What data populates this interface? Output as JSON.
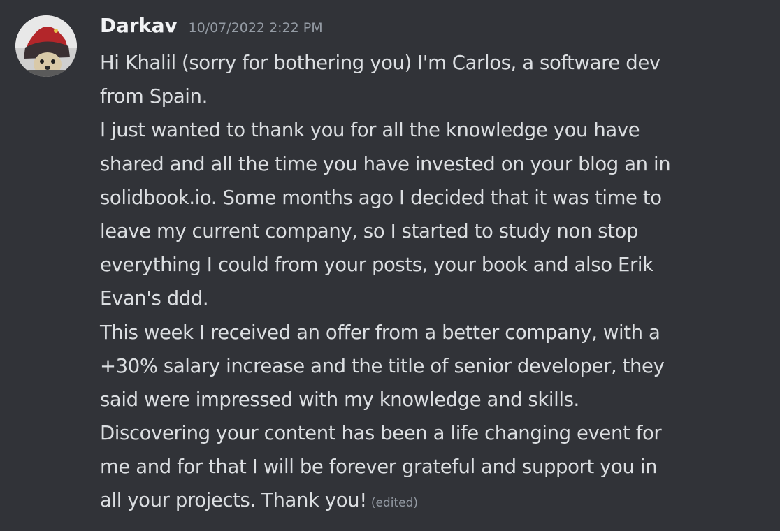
{
  "message": {
    "author": {
      "username": "Darkav",
      "avatar_icon": "avatar-icon"
    },
    "timestamp": "10/07/2022 2:22 PM",
    "lines": [
      "Hi Khalil (sorry for bothering you) I'm Carlos, a software dev",
      "from Spain.",
      "I just wanted to thank you for all the knowledge you have",
      "shared and all the time you have invested on your blog an in",
      "solidbook.io. Some months ago I decided that it was time to",
      "leave my current company, so I started to study non stop",
      "everything I could from your posts, your book and also Erik",
      "Evan's ddd.",
      "This week I received an offer from a better company, with a",
      "+30% salary increase and the title of senior developer, they",
      "said were impressed with my knowledge and skills.",
      "Discovering your content has been a life changing event for",
      "me and for that I will be forever grateful and support you in",
      "all your projects. Thank you!"
    ],
    "edited_label": "(edited)"
  },
  "colors": {
    "background": "#313338",
    "text": "#dbdee1",
    "username": "#f2f3f5",
    "muted": "#949ba4"
  }
}
